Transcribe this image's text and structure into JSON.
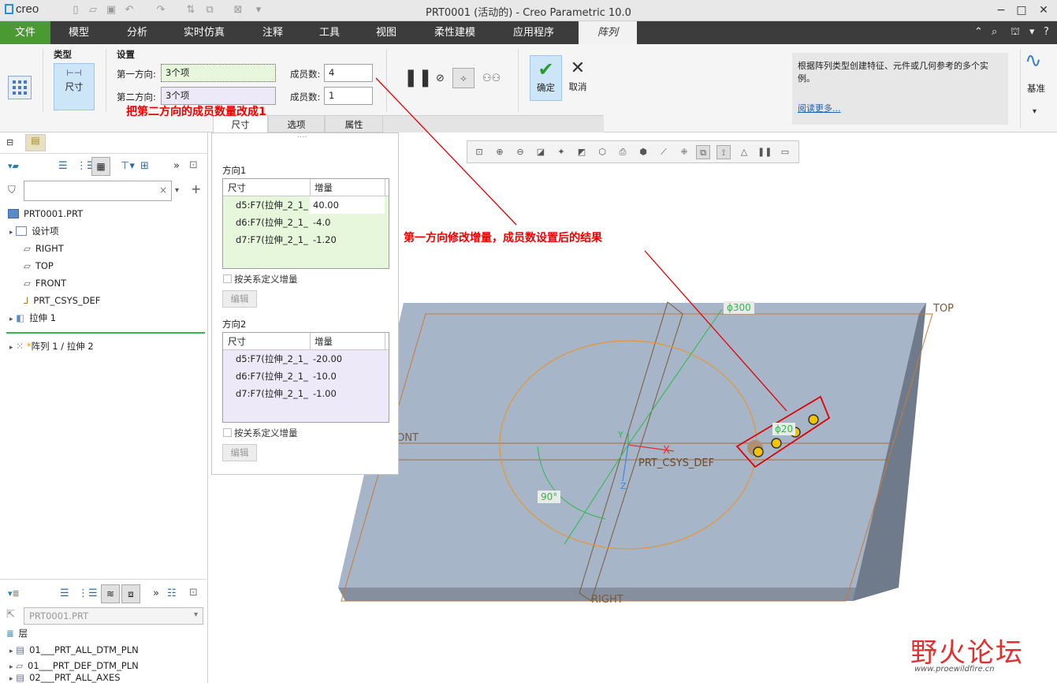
{
  "app": {
    "logo": "creo",
    "title": "PRT0001 (活动的) - Creo Parametric 10.0"
  },
  "quick_access": [
    "new-icon",
    "open-icon",
    "save-icon",
    "undo-icon",
    "redo-icon",
    "regenerate-icon",
    "windows-icon",
    "close-window-icon",
    "customize-icon"
  ],
  "menu": {
    "file": "文件",
    "tabs": [
      "模型",
      "分析",
      "实时仿真",
      "注释",
      "工具",
      "视图",
      "柔性建模",
      "应用程序"
    ],
    "active_tab": "阵列"
  },
  "ribbon": {
    "type_group": "类型",
    "type_button": "尺寸",
    "settings_group": "设置",
    "dir1_label": "第一方向:",
    "dir1_value": "3个项",
    "dir2_label": "第二方向:",
    "dir2_value": "3个项",
    "members_label1": "成员数:",
    "members_value1": "4",
    "members_label2": "成员数:",
    "members_value2": "1",
    "ok_label": "确定",
    "cancel_label": "取消",
    "tabs": [
      "尺寸",
      "选项",
      "属性"
    ],
    "info_text": "根据阵列类型创建特征、元件或几何参考的多个实例。",
    "info_link": "阅读更多...",
    "datum_label": "基准"
  },
  "model_tree": {
    "root": "PRT0001.PRT",
    "items": [
      "设计项",
      "RIGHT",
      "TOP",
      "FRONT",
      "PRT_CSYS_DEF",
      "拉伸 1"
    ],
    "insert_item": "阵列 1 / 拉伸 2",
    "insert_mark": "*"
  },
  "layer_tree": {
    "selector": "PRT0001.PRT",
    "header": "层",
    "items": [
      "01___PRT_ALL_DTM_PLN",
      "01___PRT_DEF_DTM_PLN",
      "02___PRT_ALL_AXES"
    ]
  },
  "dim_panel": {
    "dir1_title": "方向1",
    "dir2_title": "方向2",
    "col_dim": "尺寸",
    "col_inc": "增量",
    "dir1_rows": [
      {
        "dim": "d5:F7(拉伸_2_1_",
        "inc": "40.00"
      },
      {
        "dim": "d6:F7(拉伸_2_1_",
        "inc": "-4.0"
      },
      {
        "dim": "d7:F7(拉伸_2_1_",
        "inc": "-1.20"
      }
    ],
    "dir2_rows": [
      {
        "dim": "d5:F7(拉伸_2_1_",
        "inc": "-20.00"
      },
      {
        "dim": "d6:F7(拉伸_2_1_",
        "inc": "-10.0"
      },
      {
        "dim": "d7:F7(拉伸_2_1_",
        "inc": "-1.00"
      }
    ],
    "relation_check": "按关系定义增量",
    "edit_button": "编辑"
  },
  "annotations": {
    "note1": "把第二方向的成员数量改成1",
    "note2": "第一方向修改增量，成员数设置后的结果"
  },
  "viewport": {
    "top_label": "TOP",
    "front_label": "FRONT",
    "right_label": "RIGHT",
    "csys_label": "PRT_CSYS_DEF",
    "dim_300": "ϕ300",
    "dim_20": "ϕ20",
    "angle": "90°",
    "axis_x": "X",
    "axis_y": "Y",
    "axis_z": "Z"
  },
  "watermark": {
    "text": "野火论坛",
    "url": "www.proewildfire.cn"
  },
  "colors": {
    "file_tab": "#4a9a32",
    "accent": "#2a8fd8",
    "annotation": "#e00000",
    "plate": "#a6b5c8",
    "sketch": "#e8962e",
    "dim_green": "#2fb84a"
  }
}
